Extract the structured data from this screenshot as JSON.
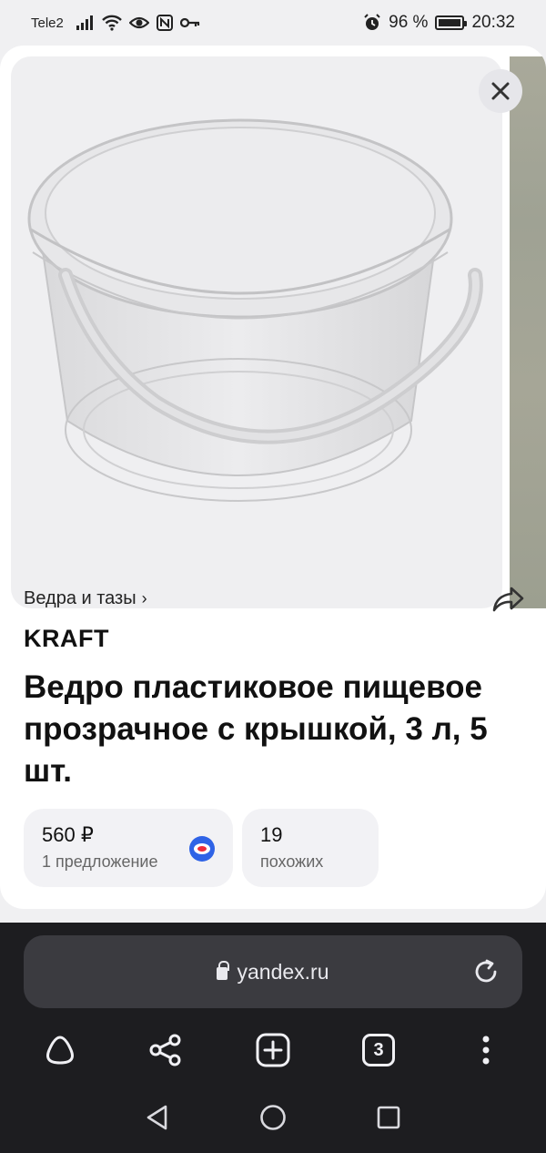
{
  "status_bar": {
    "carrier": "Tele2",
    "battery": "96 %",
    "time": "20:32"
  },
  "product": {
    "breadcrumb": "Ведра и тазы",
    "brand": "KRAFT",
    "title": "Ведро пластиковое пищевое прозрачное с крышкой, 3 л, 5 шт.",
    "price_chip": {
      "price": "560 ₽",
      "offers": "1 предложение"
    },
    "similar_chip": {
      "count": "19",
      "label": "похожих"
    }
  },
  "browser": {
    "url": "yandex.ru",
    "tabs_count": "3"
  },
  "colors": {
    "card_bg": "#ffffff",
    "chip_bg": "#f2f2f5",
    "browser_bg": "#1d1d20",
    "address_bg": "#3b3b40",
    "market_logo_blue": "#2f63e6",
    "market_logo_red": "#ef2c3a"
  },
  "icons": [
    "wifi-icon",
    "eye-icon",
    "nfc-icon",
    "key-icon",
    "alarm-icon",
    "battery-icon",
    "close-icon",
    "share-icon",
    "lock-icon",
    "reload-icon",
    "alice-icon",
    "share-nodes-icon",
    "new-tab-icon",
    "tabs-icon",
    "more-icon",
    "back-icon",
    "home-icon",
    "recents-icon"
  ]
}
